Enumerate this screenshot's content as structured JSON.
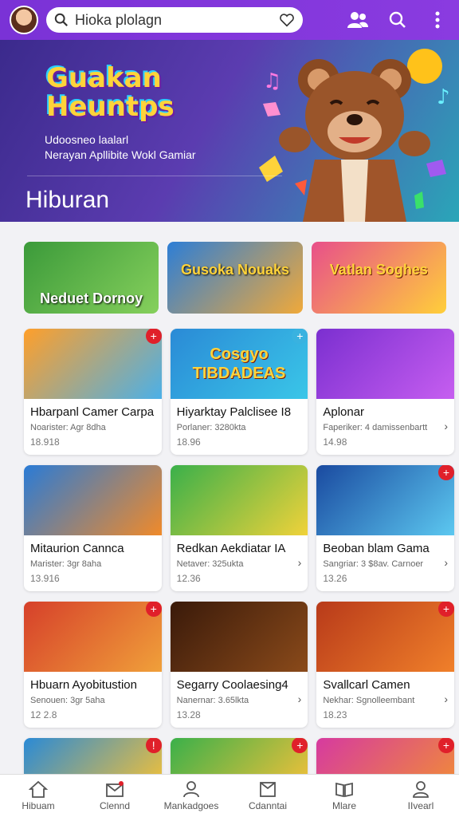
{
  "search": {
    "text": "Hioka plolagn"
  },
  "hero": {
    "logo_line1": "Guakan",
    "logo_line2": "Heuntps",
    "sub1": "Udoosneo laalarl",
    "sub2": "Nerayan Apllibite Wokl Gamiar",
    "title": "Hiburan"
  },
  "featured": [
    {
      "label": "Neduet Dornoy",
      "colors": [
        "#3b9a3a",
        "#86d05c"
      ]
    },
    {
      "label": "Gusoka Nouaks",
      "colors": [
        "#2d7ed6",
        "#f0a93a"
      ]
    },
    {
      "label": "Vatlan Soghes",
      "colors": [
        "#e84f8a",
        "#ffcf3a"
      ]
    }
  ],
  "games": [
    [
      {
        "title": "Hbarpanl Camer Carpa",
        "sub": "Noarister: Agr 8dha",
        "num": "18.918",
        "badge": "+",
        "badge_color": "red",
        "colors": [
          "#ff9f2a",
          "#4bb0e8"
        ],
        "thumb_text": "",
        "chev": false
      },
      {
        "title": "Hiyarktay Palclisee I8",
        "sub": "Porlaner: 3280kta",
        "num": "18.96",
        "badge": "+",
        "badge_color": "blue",
        "colors": [
          "#2a8ad6",
          "#3ac6e8"
        ],
        "thumb_text": "Cosgyo TIBDADEAS",
        "chev": false
      },
      {
        "title": "Aplonar",
        "sub": "Faperiker: 4 damissenbartt",
        "num": "14.98",
        "badge": "",
        "badge_color": "",
        "colors": [
          "#7b2fd0",
          "#c65ef0"
        ],
        "thumb_text": "",
        "chev": true
      }
    ],
    [
      {
        "title": "Mitaurion Cannca",
        "sub": "Marister: 3gr 8aha",
        "num": "13.916",
        "badge": "",
        "badge_color": "",
        "colors": [
          "#2a7bd6",
          "#f08a2a"
        ],
        "thumb_text": "",
        "chev": false
      },
      {
        "title": "Redkan Aekdiatar IA",
        "sub": "Netaver: 325ukta",
        "num": "12.36",
        "badge": "",
        "badge_color": "",
        "colors": [
          "#3ab04a",
          "#f0d23a"
        ],
        "thumb_text": "",
        "chev": true
      },
      {
        "title": "Beoban blam Gama",
        "sub": "Sangriar: 3 $8av. Carnoer",
        "num": "13.26",
        "badge": "+",
        "badge_color": "red",
        "colors": [
          "#1a4aa0",
          "#5cc8f0"
        ],
        "thumb_text": "",
        "chev": true
      }
    ],
    [
      {
        "title": "Hbuarn Ayobitustion",
        "sub": "Senouen: 3gr 5aha",
        "num": "12 2.8",
        "badge": "+",
        "badge_color": "red",
        "colors": [
          "#d6402a",
          "#f0a03a"
        ],
        "thumb_text": "",
        "chev": false
      },
      {
        "title": "Segarry Coolaesing4",
        "sub": "Nanernar: 3.65lkta",
        "num": "13.28",
        "badge": "",
        "badge_color": "",
        "colors": [
          "#3a1a0a",
          "#8a4a1a"
        ],
        "thumb_text": "",
        "chev": true
      },
      {
        "title": "Svallcarl Camen",
        "sub": "Nekhar: Sgnolleembant",
        "num": "18.23",
        "badge": "+",
        "badge_color": "red",
        "colors": [
          "#b83a1a",
          "#f0802a"
        ],
        "thumb_text": "",
        "chev": true
      }
    ]
  ],
  "partial_row": [
    {
      "colors": [
        "#2a8ad6",
        "#f0c03a"
      ],
      "badge": "!"
    },
    {
      "colors": [
        "#3ab04a",
        "#f0c03a"
      ],
      "badge": "+"
    },
    {
      "colors": [
        "#d63aa0",
        "#f08a3a"
      ],
      "badge": "+"
    }
  ],
  "nav": [
    {
      "label": "Hibuam",
      "icon": "home-icon"
    },
    {
      "label": "Clennd",
      "icon": "mail-icon"
    },
    {
      "label": "Mankadgoes",
      "icon": "person-icon"
    },
    {
      "label": "Cdanntai",
      "icon": "box-icon"
    },
    {
      "label": "Mlare",
      "icon": "book-icon"
    },
    {
      "label": "IIvearl",
      "icon": "profile-icon"
    }
  ]
}
